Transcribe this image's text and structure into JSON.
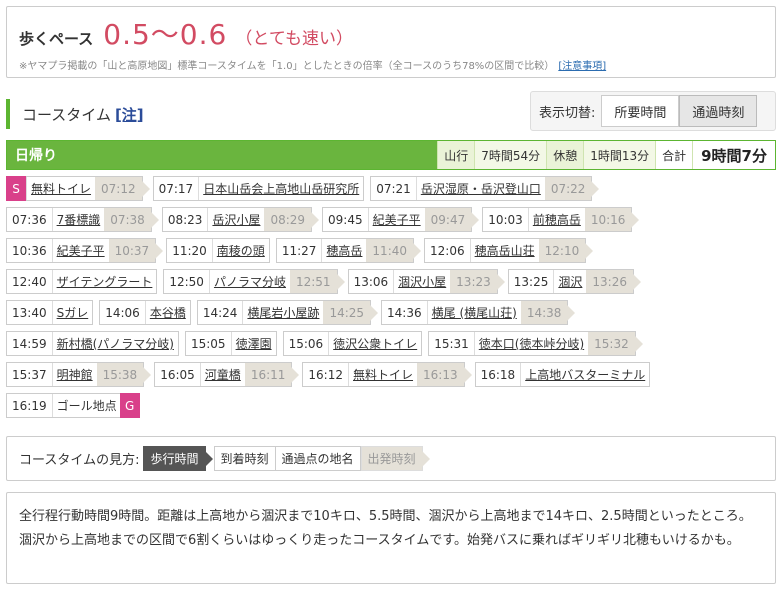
{
  "pace": {
    "label": "歩くペース",
    "value": "0.5〜0.6",
    "note": "（とても速い）",
    "sub": "※ヤマプラ掲載の「山と高原地図」標準コースタイムを「1.0」としたときの倍率（全コースのうち78%の区間で比較）",
    "sub_link": "[注意事項]"
  },
  "course": {
    "title": "コースタイム",
    "note": "[注]",
    "toggle_label": "表示切替:",
    "toggle_options": [
      "所要時間",
      "通過時刻"
    ],
    "toggle_active": "通過時刻"
  },
  "summary": {
    "title": "日帰り",
    "walk_label": "山行",
    "walk_value": "7時間54分",
    "rest_label": "休憩",
    "rest_value": "1時間13分",
    "total_label": "合計",
    "total_value": "9時間7分"
  },
  "start_badge": "S",
  "goal_badge": "G",
  "rows": [
    [
      {
        "start": true,
        "name": "無料トイレ",
        "dep": "07:12"
      },
      {
        "arr": "07:17",
        "name": "日本山岳会上高地山岳研究所"
      },
      {
        "arr": "07:21",
        "name": "岳沢湿原・岳沢登山口",
        "dep": "07:22"
      }
    ],
    [
      {
        "arr": "07:36",
        "name": "7番標識",
        "dep": "07:38"
      },
      {
        "arr": "08:23",
        "name": "岳沢小屋",
        "dep": "08:29"
      },
      {
        "arr": "09:45",
        "name": "紀美子平",
        "dep": "09:47"
      },
      {
        "arr": "10:03",
        "name": "前穂高岳",
        "dep": "10:16"
      }
    ],
    [
      {
        "arr": "10:36",
        "name": "紀美子平",
        "dep": "10:37"
      },
      {
        "arr": "11:20",
        "name": "南稜の頭"
      },
      {
        "arr": "11:27",
        "name": "穂高岳",
        "dep": "11:40"
      },
      {
        "arr": "12:06",
        "name": "穂高岳山荘",
        "dep": "12:10"
      }
    ],
    [
      {
        "arr": "12:40",
        "name": "ザイテングラート"
      },
      {
        "arr": "12:50",
        "name": "パノラマ分岐",
        "dep": "12:51"
      },
      {
        "arr": "13:06",
        "name": "涸沢小屋",
        "dep": "13:23"
      },
      {
        "arr": "13:25",
        "name": "涸沢",
        "dep": "13:26"
      }
    ],
    [
      {
        "arr": "13:40",
        "name": "Sガレ"
      },
      {
        "arr": "14:06",
        "name": "本谷橋"
      },
      {
        "arr": "14:24",
        "name": "横尾岩小屋跡",
        "dep": "14:25"
      },
      {
        "arr": "14:36",
        "name": "横尾 (横尾山荘)",
        "dep": "14:38"
      }
    ],
    [
      {
        "arr": "14:59",
        "name": "新村橋(パノラマ分岐)"
      },
      {
        "arr": "15:05",
        "name": "徳澤園"
      },
      {
        "arr": "15:06",
        "name": "徳沢公衆トイレ"
      },
      {
        "arr": "15:31",
        "name": "徳本口(徳本峠分岐)",
        "dep": "15:32"
      }
    ],
    [
      {
        "arr": "15:37",
        "name": "明神館",
        "dep": "15:38"
      },
      {
        "arr": "16:05",
        "name": "河童橋",
        "dep": "16:11"
      },
      {
        "arr": "16:12",
        "name": "無料トイレ",
        "dep": "16:13"
      },
      {
        "arr": "16:18",
        "name": "上高地バスターミナル"
      }
    ],
    [
      {
        "arr": "16:19",
        "name": "ゴール地点",
        "goal": true
      }
    ]
  ],
  "legend": {
    "label": "コースタイムの見方:",
    "walk": "歩行時間",
    "arrive": "到着時刻",
    "point": "通過点の地名",
    "depart": "出発時刻"
  },
  "description": "全行程行動時間9時間。距離は上高地から涸沢まで10キロ、5.5時間、涸沢から上高地まで14キロ、2.5時間といったところ。涸沢から上高地までの区間で6割くらいはゆっくり走ったコースタイムです。始発バスに乗ればギリギリ北穂もいけるかも。"
}
